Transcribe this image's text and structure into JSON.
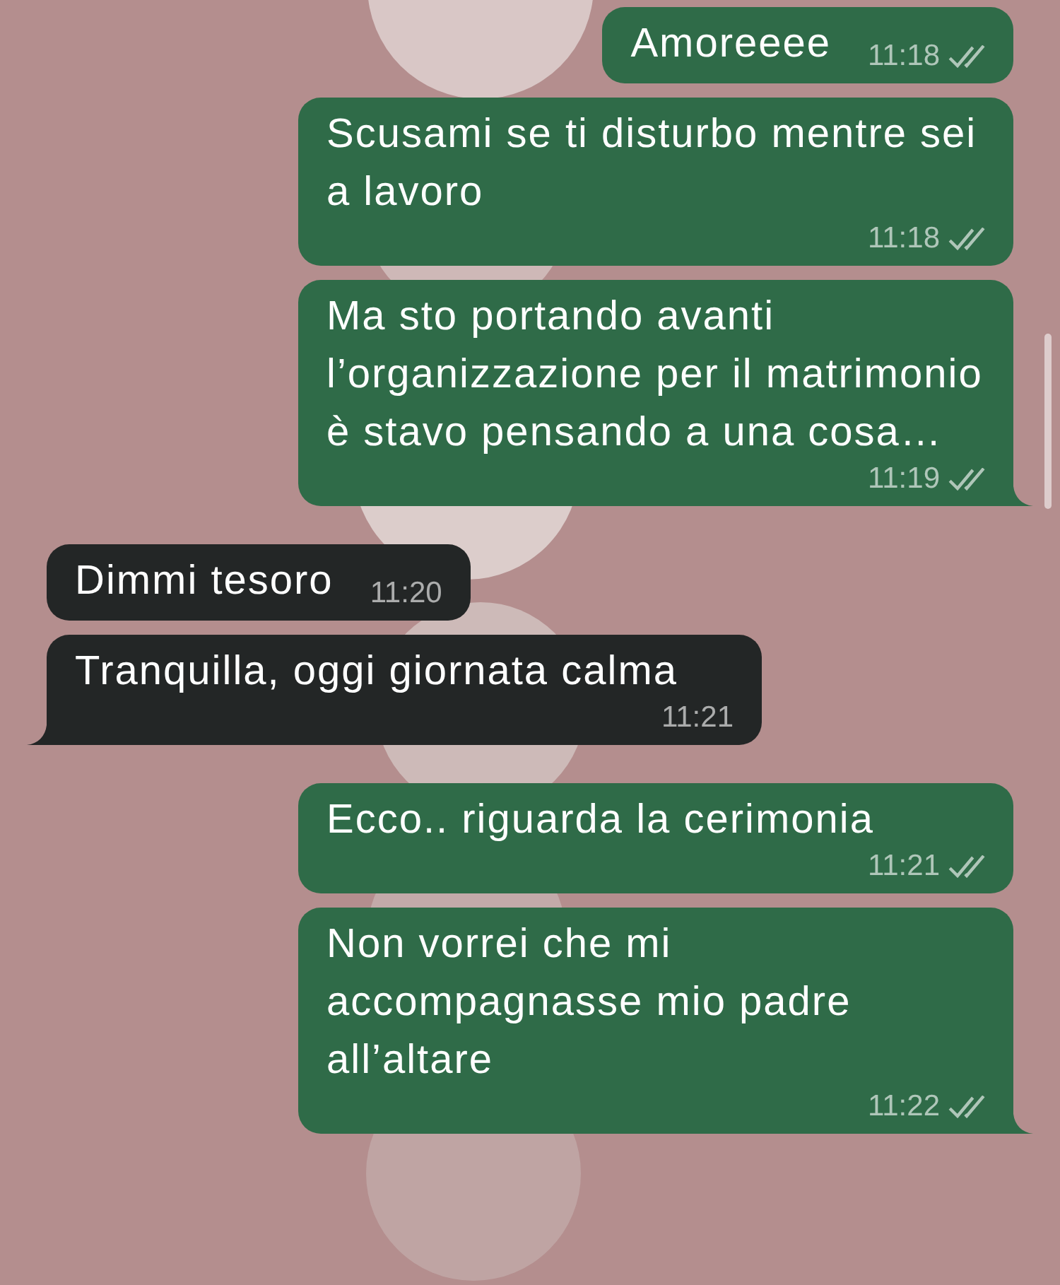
{
  "messages": [
    {
      "outgoing": true,
      "text": "Amoreeee",
      "time": "11:18",
      "read": false,
      "tail": false
    },
    {
      "outgoing": true,
      "text": "Scusami se ti disturbo mentre sei a lavoro",
      "time": "11:18",
      "read": false,
      "tail": false
    },
    {
      "outgoing": true,
      "text": "Ma sto portando avanti l’organizzazione per il matrimonio è stavo pensando a una cosa…",
      "time": "11:19",
      "read": false,
      "tail": true
    },
    {
      "outgoing": false,
      "text": "Dimmi tesoro",
      "time": "11:20",
      "tail": false
    },
    {
      "outgoing": false,
      "text": "Tranquilla, oggi giornata calma",
      "time": "11:21",
      "tail": true
    },
    {
      "outgoing": true,
      "text": "Ecco.. riguarda la cerimonia",
      "time": "11:21",
      "read": false,
      "tail": false
    },
    {
      "outgoing": true,
      "text": "Non vorrei che mi accompagnasse mio padre all’altare",
      "time": "11:22",
      "read": false,
      "tail": true
    }
  ]
}
